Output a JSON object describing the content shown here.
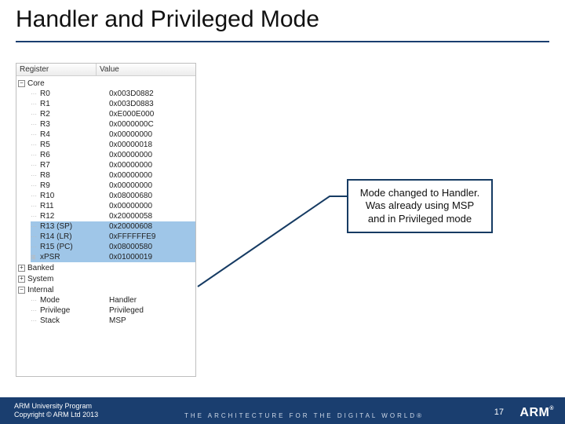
{
  "title": "Handler and Privileged Mode",
  "panel": {
    "columns": {
      "register": "Register",
      "value": "Value"
    },
    "core_label": "Core",
    "registers": [
      {
        "name": "R0",
        "value": "0x003D0882",
        "hl": false
      },
      {
        "name": "R1",
        "value": "0x003D0883",
        "hl": false
      },
      {
        "name": "R2",
        "value": "0xE000E000",
        "hl": false
      },
      {
        "name": "R3",
        "value": "0x0000000C",
        "hl": false
      },
      {
        "name": "R4",
        "value": "0x00000000",
        "hl": false
      },
      {
        "name": "R5",
        "value": "0x00000018",
        "hl": false
      },
      {
        "name": "R6",
        "value": "0x00000000",
        "hl": false
      },
      {
        "name": "R7",
        "value": "0x00000000",
        "hl": false
      },
      {
        "name": "R8",
        "value": "0x00000000",
        "hl": false
      },
      {
        "name": "R9",
        "value": "0x00000000",
        "hl": false
      },
      {
        "name": "R10",
        "value": "0x08000680",
        "hl": false
      },
      {
        "name": "R11",
        "value": "0x00000000",
        "hl": false
      },
      {
        "name": "R12",
        "value": "0x20000058",
        "hl": false
      },
      {
        "name": "R13 (SP)",
        "value": "0x20000608",
        "hl": true
      },
      {
        "name": "R14 (LR)",
        "value": "0xFFFFFFE9",
        "hl": true
      },
      {
        "name": "R15 (PC)",
        "value": "0x08000580",
        "hl": true
      },
      {
        "name": "xPSR",
        "value": "0x01000019",
        "hl": true,
        "expandable": true
      }
    ],
    "banked_label": "Banked",
    "system_label": "System",
    "internal_label": "Internal",
    "internal": [
      {
        "name": "Mode",
        "value": "Handler"
      },
      {
        "name": "Privilege",
        "value": "Privileged"
      },
      {
        "name": "Stack",
        "value": "MSP"
      }
    ]
  },
  "callout": "Mode changed to Handler. Was already using MSP and in Privileged mode",
  "footer": {
    "line1": "ARM University Program",
    "line2": "Copyright © ARM Ltd 2013",
    "tagline": "THE ARCHITECTURE FOR THE DIGITAL WORLD®",
    "page": "17",
    "logo": "ARM",
    "reg": "®"
  }
}
